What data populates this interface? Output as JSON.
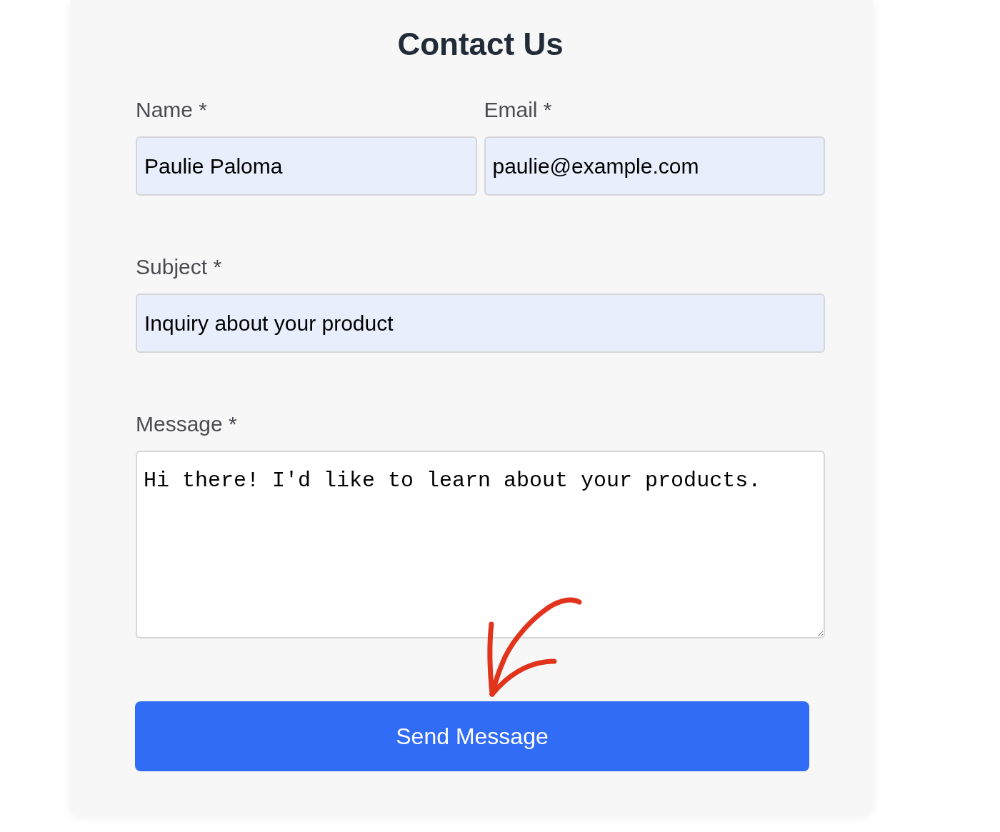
{
  "title": "Contact Us",
  "field_rows": [
    {
      "fields": [
        {
          "kind": "text",
          "label": "Name *",
          "value": "Paulie Paloma",
          "autofilled": true
        },
        {
          "kind": "text",
          "label": "Email *",
          "value": "paulie@example.com",
          "autofilled": true
        }
      ]
    },
    {
      "fields": [
        {
          "kind": "text",
          "label": "Subject *",
          "value": "Inquiry about your product",
          "autofilled": true
        }
      ]
    },
    {
      "fields": [
        {
          "kind": "textarea",
          "label": "Message *",
          "value": "Hi there! I'd like to learn about your products.",
          "autofilled": false
        }
      ]
    }
  ],
  "submit_button": {
    "label": "Send Message"
  }
}
